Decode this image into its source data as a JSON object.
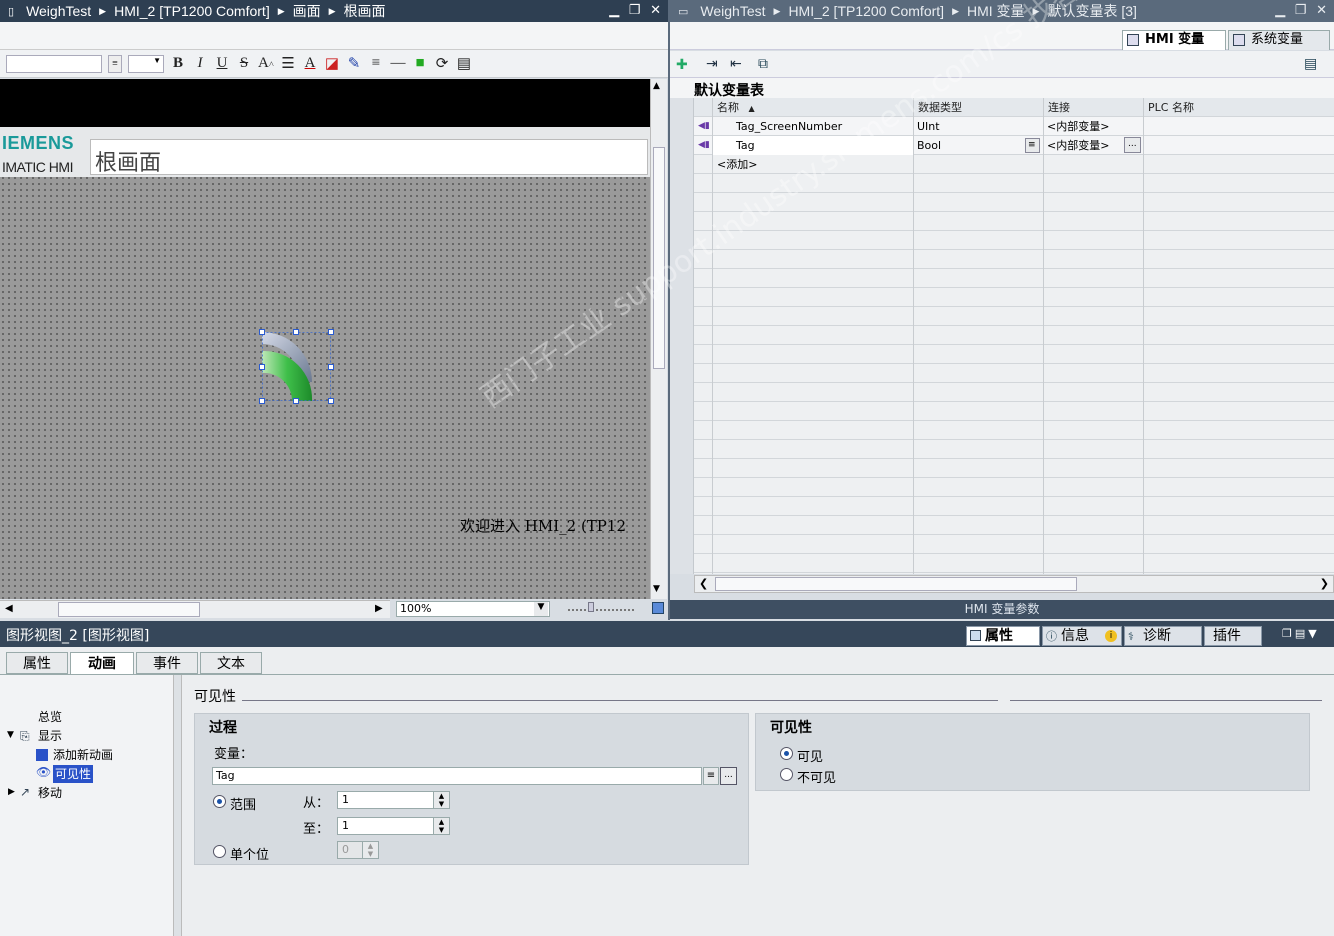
{
  "left_title": {
    "crumbs": [
      "WeighTest",
      "HMI_2 [TP1200 Comfort]",
      "画面",
      "根画面"
    ]
  },
  "right_title": {
    "crumbs": [
      "WeighTest",
      "HMI_2 [TP1200 Comfort]",
      "HMI 变量",
      "默认变量表 [3]"
    ]
  },
  "window_controls": "▁ ❐ ✕",
  "tabs_top": {
    "hmi_tags": "HMI 变量",
    "system_tags": "系统变量"
  },
  "toolbar": {
    "bold": "B",
    "italic": "I",
    "underline": "U",
    "strike": "S"
  },
  "screen": {
    "logo": "IEMENS",
    "logo_sub": "IMATIC HMI",
    "title": "根画面",
    "welcome": "欢迎进入 HMI_2 (TP12",
    "zoom": "100%"
  },
  "tag_table": {
    "title": "默认变量表",
    "columns": [
      "名称",
      "数据类型",
      "连接",
      "PLC 名称"
    ],
    "rows": [
      {
        "name": "Tag_ScreenNumber",
        "type": "UInt",
        "conn": "<内部变量>"
      },
      {
        "name": "Tag",
        "type": "Bool",
        "conn": "<内部变量>"
      }
    ],
    "add": "<添加>",
    "params_bar": "HMI 变量参数"
  },
  "inspector": {
    "title": "图形视图_2 [图形视图]",
    "side_tabs": [
      "属性",
      "信息",
      "诊断",
      "插件"
    ],
    "tabs": [
      "属性",
      "动画",
      "事件",
      "文本"
    ],
    "active_tab": "动画",
    "tree": [
      "总览",
      "显示",
      "添加新动画",
      "可见性",
      "移动"
    ],
    "section_title": "可见性",
    "process": {
      "title": "过程",
      "var_label": "变量：",
      "var_value": "Tag",
      "range_label": "范围",
      "from_label": "从：",
      "from_value": "1",
      "to_label": "至：",
      "to_value": "1",
      "single_label": "单个位",
      "single_value": "0"
    },
    "visibility": {
      "title": "可见性",
      "visible": "可见",
      "invisible": "不可见"
    }
  },
  "watermark": "西门子工业 support.industry.siemens.com/cs 找答案"
}
